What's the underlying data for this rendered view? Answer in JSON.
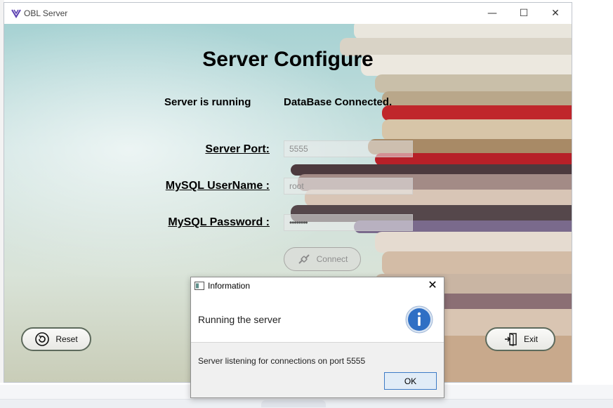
{
  "window": {
    "title": "OBL Server",
    "controls": {
      "minimize": "—",
      "maximize": "☐",
      "close": "✕"
    }
  },
  "main": {
    "heading": "Server Configure",
    "server_status": "Server is running",
    "db_status": "DataBase Connected.",
    "fields": {
      "port_label": "Server Port:",
      "port_value": "5555",
      "user_label": "MySQL UserName :",
      "user_value": "root",
      "password_label": "MySQL Password :",
      "password_value": "••••••••"
    },
    "connect_label": "Connect",
    "reset_label": "Reset",
    "exit_label": "Exit"
  },
  "dialog": {
    "title": "Information",
    "close": "✕",
    "header": "Running the server",
    "message": "Server listening for connections on port 5555",
    "ok_label": "OK"
  },
  "colors": {
    "accent_blue": "#3d7bc6",
    "info_icon": "#2f6fc4",
    "book_red": "#c8202a"
  }
}
